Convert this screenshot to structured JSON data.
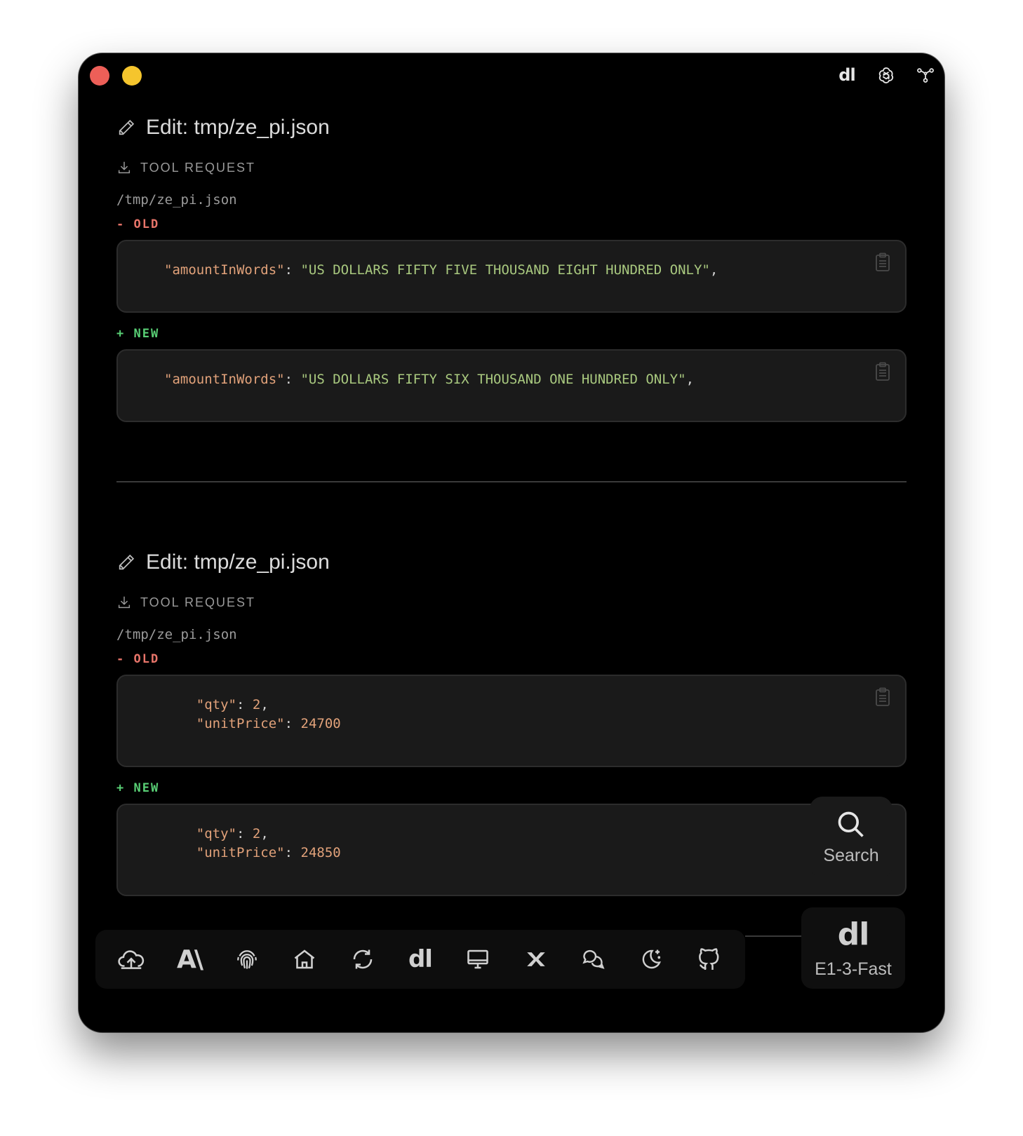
{
  "top_icons": {
    "dl_logo": "dl"
  },
  "edits": [
    {
      "title": "Edit: tmp/ze_pi.json",
      "tool_request": "TOOL REQUEST",
      "path": "/tmp/ze_pi.json",
      "old_label": "- OLD",
      "new_label": "+ NEW",
      "old_lines": [
        [
          {
            "t": "k",
            "v": "\"amountInWords\""
          },
          {
            "t": "p",
            "v": ": "
          },
          {
            "t": "s",
            "v": "\"US DOLLARS FIFTY FIVE THOUSAND EIGHT HUNDRED ONLY\""
          },
          {
            "t": "p",
            "v": ","
          }
        ]
      ],
      "new_lines": [
        [
          {
            "t": "k",
            "v": "\"amountInWords\""
          },
          {
            "t": "p",
            "v": ": "
          },
          {
            "t": "s",
            "v": "\"US DOLLARS FIFTY SIX THOUSAND ONE HUNDRED ONLY\""
          },
          {
            "t": "p",
            "v": ","
          }
        ]
      ]
    },
    {
      "title": "Edit: tmp/ze_pi.json",
      "tool_request": "TOOL REQUEST",
      "path": "/tmp/ze_pi.json",
      "old_label": "- OLD",
      "new_label": "+ NEW",
      "old_lines": [
        [
          {
            "t": "p",
            "v": "    "
          },
          {
            "t": "k",
            "v": "\"qty\""
          },
          {
            "t": "p",
            "v": ": "
          },
          {
            "t": "n",
            "v": "2"
          },
          {
            "t": "p",
            "v": ","
          }
        ],
        [
          {
            "t": "p",
            "v": "    "
          },
          {
            "t": "k",
            "v": "\"unitPrice\""
          },
          {
            "t": "p",
            "v": ": "
          },
          {
            "t": "n",
            "v": "24700"
          }
        ]
      ],
      "new_lines": [
        [
          {
            "t": "p",
            "v": "    "
          },
          {
            "t": "k",
            "v": "\"qty\""
          },
          {
            "t": "p",
            "v": ": "
          },
          {
            "t": "n",
            "v": "2"
          },
          {
            "t": "p",
            "v": ","
          }
        ],
        [
          {
            "t": "p",
            "v": "    "
          },
          {
            "t": "k",
            "v": "\"unitPrice\""
          },
          {
            "t": "p",
            "v": ": "
          },
          {
            "t": "n",
            "v": "24850"
          }
        ]
      ]
    }
  ],
  "search": {
    "label": "Search"
  },
  "bottom_bar": {
    "icons": [
      "cloud-upload-icon",
      "anthropic-icon",
      "fingerprint-icon",
      "home-icon",
      "refresh-icon",
      "dl-icon",
      "monitor-icon",
      "x-icon",
      "chat-icon",
      "moon-sparkle-icon",
      "github-icon"
    ],
    "dl_text": "dl",
    "anthropic_text": "A\\"
  },
  "model": {
    "logo": "dl",
    "label": "E1-3-Fast"
  },
  "colors": {
    "window_bg": "#000000",
    "code_bg": "#1a1a1a",
    "old": "#e8756a",
    "new": "#59cf75",
    "key": "#e2a27a",
    "string": "#a9c97f"
  }
}
